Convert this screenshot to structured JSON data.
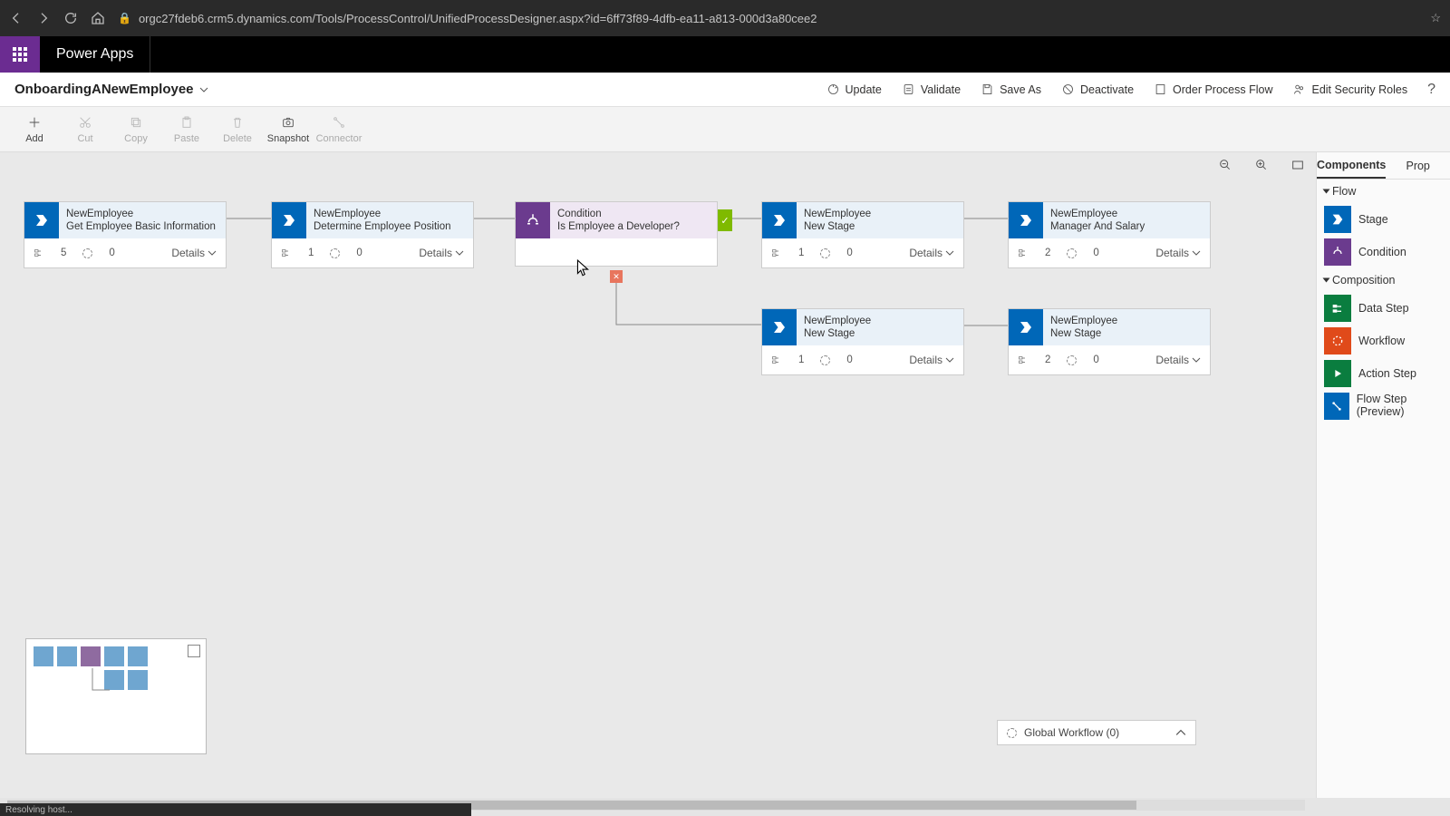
{
  "browser": {
    "url": "orgc27fdeb6.crm5.dynamics.com/Tools/ProcessControl/UnifiedProcessDesigner.aspx?id=6ff73f89-4dfb-ea11-a813-000d3a80cee2"
  },
  "app_title": "Power Apps",
  "process_name": "OnboardingANewEmployee",
  "commands": {
    "update": "Update",
    "validate": "Validate",
    "save_as": "Save As",
    "deactivate": "Deactivate",
    "order": "Order Process Flow",
    "security": "Edit Security Roles"
  },
  "toolbar": {
    "add": "Add",
    "cut": "Cut",
    "copy": "Copy",
    "paste": "Paste",
    "delete": "Delete",
    "snapshot": "Snapshot",
    "connector": "Connector"
  },
  "nodes": {
    "n1": {
      "entity": "NewEmployee",
      "title": "Get Employee Basic Information",
      "steps": "5",
      "wf": "0",
      "details": "Details"
    },
    "n2": {
      "entity": "NewEmployee",
      "title": "Determine Employee Position",
      "steps": "1",
      "wf": "0",
      "details": "Details"
    },
    "n3": {
      "entity": "Condition",
      "title": "Is Employee a Developer?"
    },
    "n4": {
      "entity": "NewEmployee",
      "title": "New Stage",
      "steps": "1",
      "wf": "0",
      "details": "Details"
    },
    "n5": {
      "entity": "NewEmployee",
      "title": "Manager And Salary",
      "steps": "2",
      "wf": "0",
      "details": "Details"
    },
    "n6": {
      "entity": "NewEmployee",
      "title": "New Stage",
      "steps": "1",
      "wf": "0",
      "details": "Details"
    },
    "n7": {
      "entity": "NewEmployee",
      "title": "New Stage",
      "steps": "2",
      "wf": "0",
      "details": "Details"
    }
  },
  "global_workflow": "Global Workflow (0)",
  "panel": {
    "tab1": "Components",
    "tab2": "Prop",
    "flow": "Flow",
    "composition": "Composition",
    "stage": "Stage",
    "condition": "Condition",
    "data_step": "Data Step",
    "workflow": "Workflow",
    "action_step": "Action Step",
    "flow_step": "Flow Step (Preview)"
  },
  "status": "Resolving host..."
}
